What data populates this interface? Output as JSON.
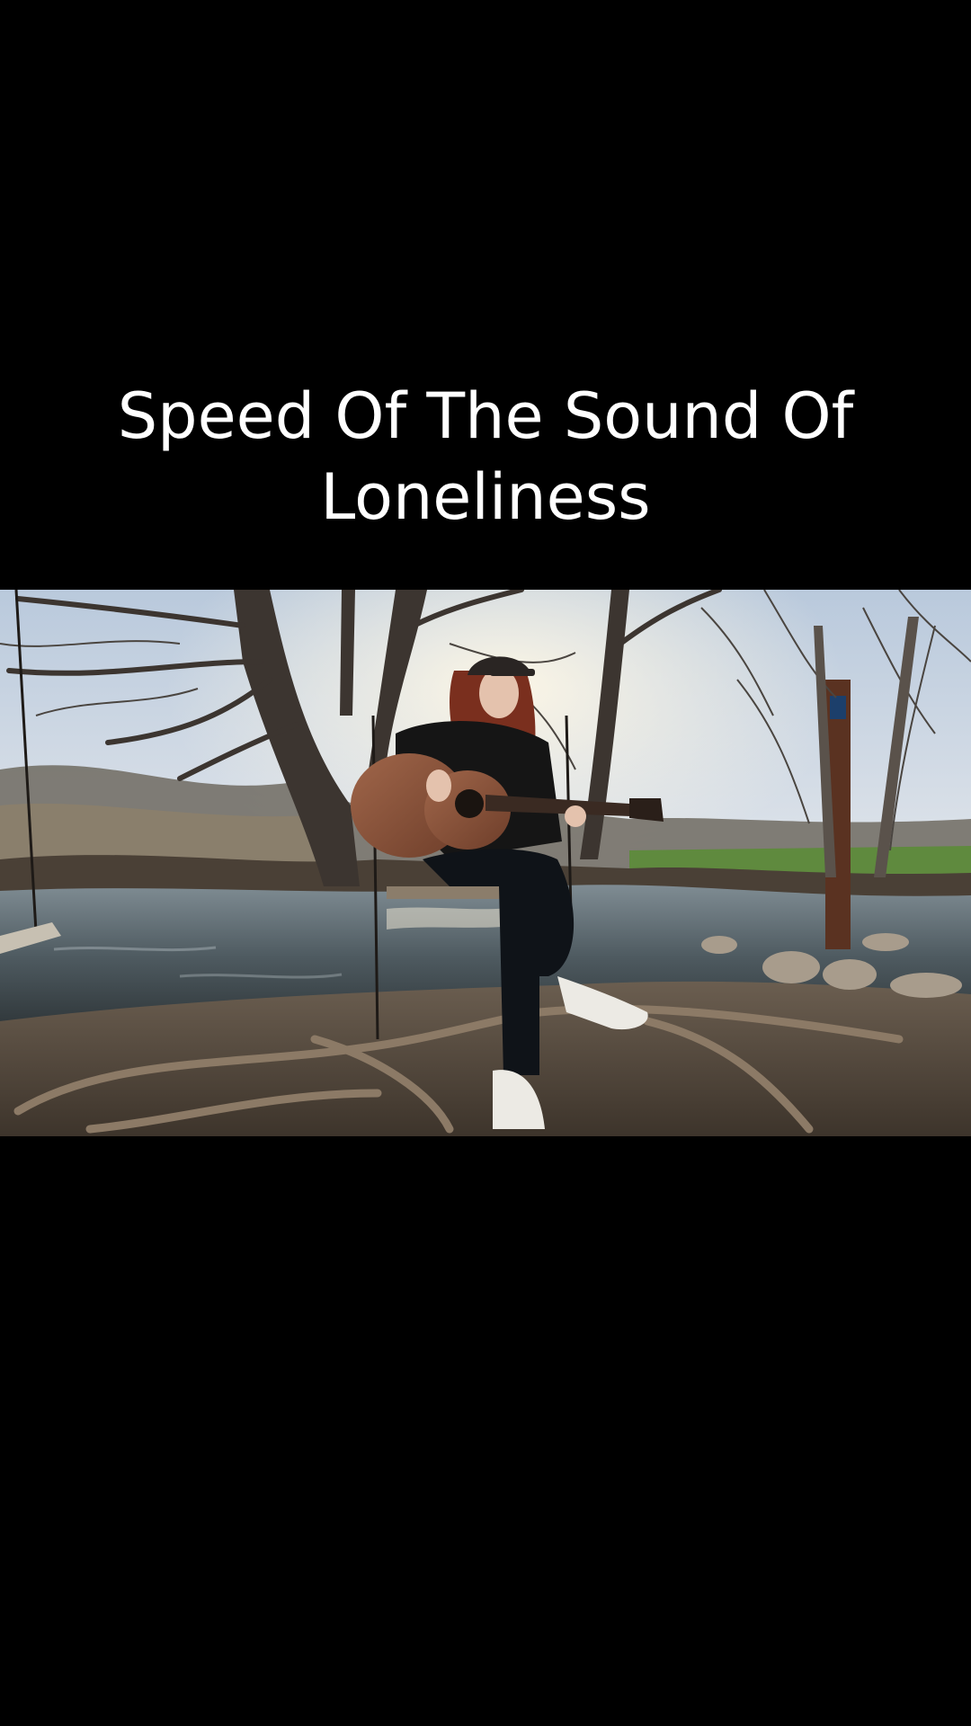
{
  "caption": {
    "line1": "Speed Of The Sound Of",
    "line2": "Loneliness"
  },
  "colors": {
    "background": "#000000",
    "caption_text": "#ffffff"
  }
}
